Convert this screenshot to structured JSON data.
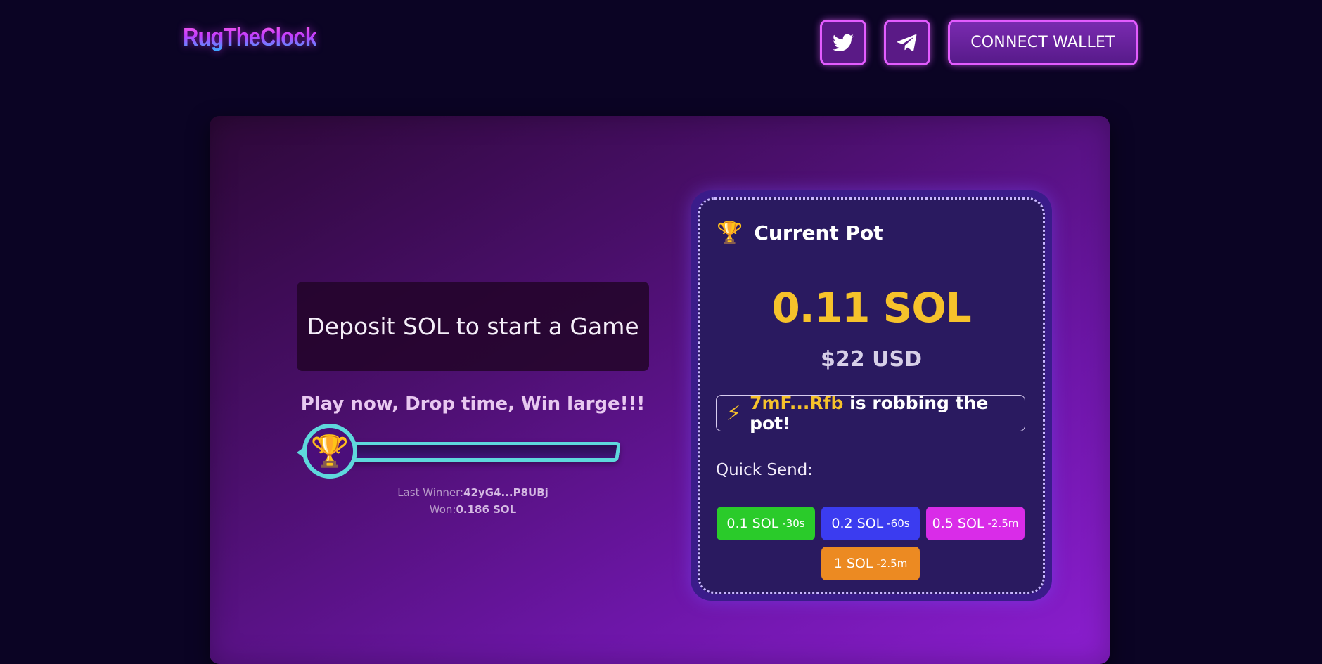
{
  "header": {
    "logo_text": "RugTheClock",
    "twitter_icon": "twitter-bird-icon",
    "telegram_icon": "telegram-plane-icon",
    "connect_label": "CONNECT WALLET",
    "accent_color": "#e35cff"
  },
  "game": {
    "deposit_prompt": "Deposit SOL to start a Game",
    "tagline": "Play now, Drop time, Win large!!!",
    "progress_fraction": 0,
    "badge_icon": "trophy-icon",
    "last_winner_label": "Last Winner:",
    "last_winner_value": "42yG4...P8UBj",
    "won_label": "Won:",
    "won_value": "0.186 SOL"
  },
  "pot": {
    "title": "Current Pot",
    "title_icon": "trophy-icon",
    "amount": "0.11 SOL",
    "usd": "$22 USD",
    "robber_icon": "lightning-icon",
    "robber_address": "7mF...Rfb",
    "robber_message": "is robbing the pot!",
    "quick_send_label": "Quick Send:",
    "quick_send": [
      {
        "amount": "0.1 SOL",
        "time": "-30s",
        "color": "#2acb2a"
      },
      {
        "amount": "0.2 SOL",
        "time": "-60s",
        "color": "#3b3cf0"
      },
      {
        "amount": "0.5 SOL",
        "time": "-2.5m",
        "color": "#d92ce8"
      },
      {
        "amount": "1 SOL",
        "time": "-2.5m",
        "color": "#ec8a22"
      }
    ]
  }
}
